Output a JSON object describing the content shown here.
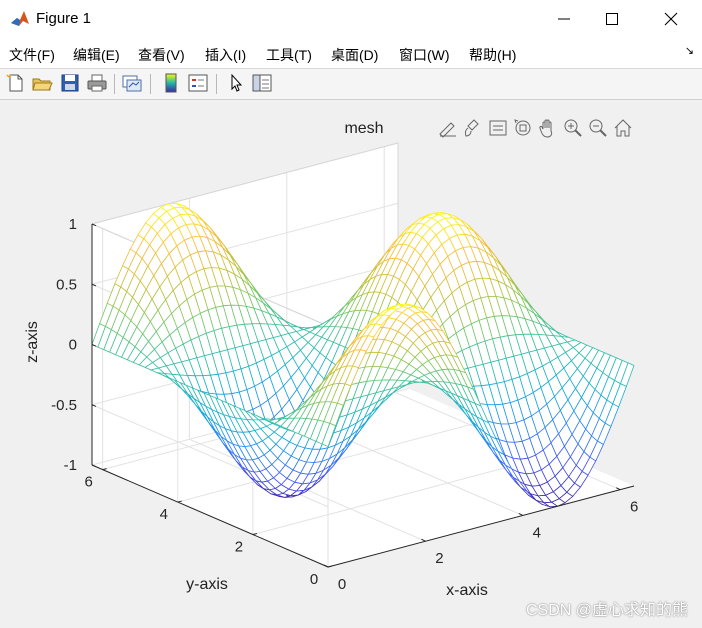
{
  "window": {
    "title": "Figure 1",
    "minimize_glyph": "minimize",
    "maximize_glyph": "maximize",
    "close_glyph": "close"
  },
  "menu": {
    "items": [
      "文件(F)",
      "编辑(E)",
      "查看(V)",
      "插入(I)",
      "工具(T)",
      "桌面(D)",
      "窗口(W)",
      "帮助(H)"
    ],
    "dock_arrow": "↘"
  },
  "toolbar": {
    "icons": [
      "new-figure-icon",
      "open-file-icon",
      "save-icon",
      "print-icon",
      "link-plot-icon",
      "colorbar-icon",
      "legend-icon",
      "pointer-icon",
      "property-inspector-icon"
    ]
  },
  "axes_toolbar": {
    "icons": [
      "export-icon",
      "brush-icon",
      "data-tips-icon",
      "rotate-3d-icon",
      "pan-icon",
      "zoom-in-icon",
      "zoom-out-icon",
      "home-icon"
    ]
  },
  "chart_data": {
    "type": "mesh",
    "title": "mesh",
    "xlabel": "x-axis",
    "ylabel": "y-axis",
    "zlabel": "z-axis",
    "function": "z = sin(x) * cos(y)",
    "x_range": [
      0,
      6.2832
    ],
    "y_range": [
      0,
      6.2832
    ],
    "xlim": [
      0,
      6.2832
    ],
    "ylim": [
      0,
      6.2832
    ],
    "zlim": [
      -1,
      1
    ],
    "x_ticks": [
      "0",
      "2",
      "4",
      "6"
    ],
    "y_ticks": [
      "0",
      "2",
      "4",
      "6"
    ],
    "z_ticks": [
      "-1",
      "-0.5",
      "0",
      "0.5",
      "1"
    ],
    "grid": true,
    "colormap": "parula",
    "view": "default 3-D"
  },
  "watermark": "CSDN @虚心求知的熊"
}
